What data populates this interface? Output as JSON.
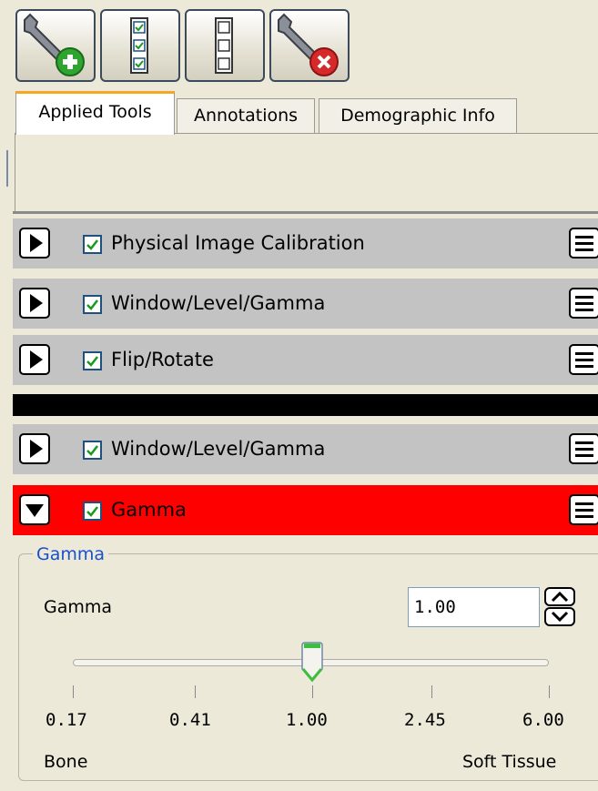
{
  "toolbar": {
    "buttons": [
      {
        "name": "add-tool-button",
        "icon": "wrench-add-icon"
      },
      {
        "name": "check-all-button",
        "icon": "checklist-icon"
      },
      {
        "name": "uncheck-all-button",
        "icon": "empty-list-icon"
      },
      {
        "name": "remove-tool-button",
        "icon": "wrench-remove-icon"
      }
    ]
  },
  "tabs": [
    {
      "label": "Applied Tools",
      "active": true
    },
    {
      "label": "Annotations",
      "active": false
    },
    {
      "label": "Demographic Info",
      "active": false
    }
  ],
  "tools": [
    {
      "label": "Physical Image Calibration",
      "checked": true,
      "expanded": false,
      "color": "#c3c3c3"
    },
    {
      "label": "Window/Level/Gamma",
      "checked": true,
      "expanded": false,
      "color": "#c3c3c3"
    },
    {
      "label": "Flip/Rotate",
      "checked": true,
      "expanded": false,
      "color": "#c3c3c3"
    },
    {
      "label": "Window/Level/Gamma",
      "checked": true,
      "expanded": false,
      "color": "#c3c3c3"
    },
    {
      "label": "Gamma",
      "checked": true,
      "expanded": true,
      "color": "#ff0000"
    }
  ],
  "gamma_panel": {
    "group_title": "Gamma",
    "field_label": "Gamma",
    "value": "1.00",
    "slider": {
      "ticks": [
        "0.17",
        "0.41",
        "1.00",
        "2.45",
        "6.00"
      ],
      "selected": "1.00",
      "left_label": "Bone",
      "right_label": "Soft Tissue"
    }
  },
  "colors": {
    "selected_row": "#ff0000",
    "row": "#c3c3c3",
    "separator": "#000000",
    "group_title": "#1a4fd0"
  }
}
